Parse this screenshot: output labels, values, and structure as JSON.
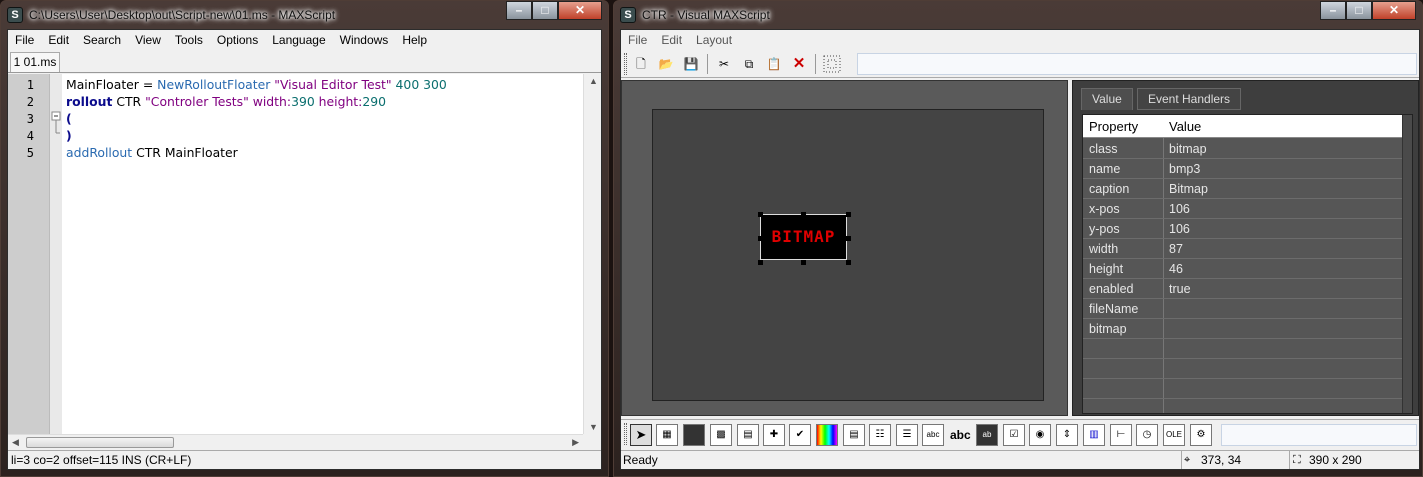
{
  "editor": {
    "title": "C:\\Users\\User\\Desktop\\out\\Script-new\\01.ms - MAXScript",
    "menu": [
      "File",
      "Edit",
      "Search",
      "View",
      "Tools",
      "Options",
      "Language",
      "Windows",
      "Help"
    ],
    "tab": "1 01.ms",
    "line_numbers": [
      "1",
      "2",
      "3",
      "4",
      "5"
    ],
    "status": "li=3 co=2 offset=115 INS (CR+LF)",
    "icon": "app-icon"
  },
  "code": {
    "l1": {
      "a": "MainFloater = ",
      "b": "NewRolloutFloater ",
      "c": "\"Visual Editor Test\"",
      "d": " 400 300"
    },
    "l2": {
      "a": "rollout",
      "b": " CTR ",
      "c": "\"Controler Tests\"",
      "d": " width:",
      "e": "390",
      "f": " height:",
      "g": "290"
    },
    "l3": "(",
    "l4": ")",
    "l5": {
      "a": "addRollout",
      "b": " CTR MainFloater"
    }
  },
  "visual": {
    "title": "CTR - Visual MAXScript",
    "menu": [
      "File",
      "Edit",
      "Layout"
    ],
    "bitmap_caption": "BITMAP",
    "tabs": [
      "Value",
      "Event Handlers"
    ],
    "grid_header": [
      "Property",
      "Value"
    ],
    "properties": [
      {
        "name": "class",
        "value": "bitmap"
      },
      {
        "name": "name",
        "value": "bmp3"
      },
      {
        "name": "caption",
        "value": "Bitmap"
      },
      {
        "name": "x-pos",
        "value": "106"
      },
      {
        "name": "y-pos",
        "value": "106"
      },
      {
        "name": "width",
        "value": "87"
      },
      {
        "name": "height",
        "value": "46"
      },
      {
        "name": "enabled",
        "value": "true"
      },
      {
        "name": "fileName",
        "value": ""
      },
      {
        "name": "bitmap",
        "value": ""
      }
    ],
    "status": "Ready",
    "cursor_pos": "373, 34",
    "size": "390 x 290",
    "abc_labels": {
      "editbox": "abc",
      "label": "abc"
    }
  },
  "colors": {
    "bitmap_text": "#e00000",
    "canvas_bg": "#444444",
    "keyword": "#0b0b8c",
    "string": "#800080",
    "number": "#0a6e6e",
    "function": "#2a6ab0"
  }
}
